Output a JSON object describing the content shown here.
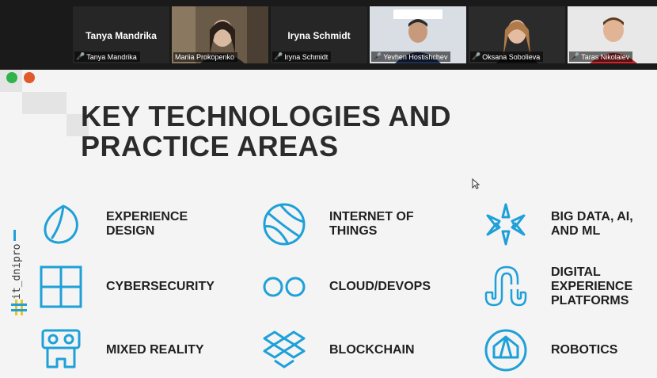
{
  "participants": [
    {
      "name": "Tanya Mandrika",
      "display": "Tanya Mandrika",
      "has_video": false
    },
    {
      "name": "Mariia Prokopenko",
      "has_video": true,
      "active": true
    },
    {
      "name": "Iryna Schmidt",
      "display": "Iryna Schmidt",
      "has_video": false
    },
    {
      "name": "Yevhen Hostishchev",
      "has_video": true
    },
    {
      "name": "Oksana Sobolieva",
      "has_video": true
    },
    {
      "name": "Taras Nikolaiev",
      "has_video": true
    }
  ],
  "slide": {
    "title_line1": "KEY TECHNOLOGIES AND",
    "title_line2": "PRACTICE AREAS",
    "brand": "it_dnipro",
    "accent_color": "#1ea0d8",
    "items": [
      {
        "label": "EXPERIENCE\nDESIGN",
        "icon": "leaf-drop-icon"
      },
      {
        "label": "INTERNET OF\nTHINGS",
        "icon": "basketball-globe-icon"
      },
      {
        "label": "BIG DATA, AI,\nAND ML",
        "icon": "radial-burst-icon"
      },
      {
        "label": "CYBERSECURITY",
        "icon": "window-grid-icon"
      },
      {
        "label": "CLOUD/DEVOPS",
        "icon": "double-circle-icon"
      },
      {
        "label": "DIGITAL\nEXPERIENCE\nPLATFORMS",
        "icon": "stumbleupon-icon"
      },
      {
        "label": "MIXED REALITY",
        "icon": "vr-headset-icon"
      },
      {
        "label": "BLOCKCHAIN",
        "icon": "dropbox-icon"
      },
      {
        "label": "ROBOTICS",
        "icon": "house-circle-icon"
      }
    ]
  }
}
